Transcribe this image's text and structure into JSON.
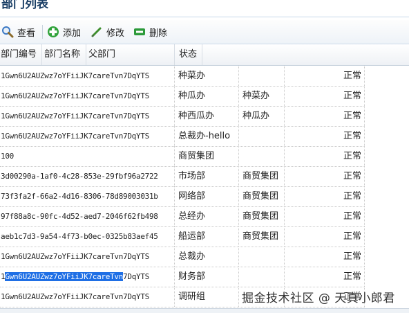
{
  "page": {
    "title": "部门列表"
  },
  "toolbar": {
    "view_label": "查看",
    "add_label": "添加",
    "edit_label": "修改",
    "delete_label": "删除"
  },
  "table": {
    "columns": [
      "部门编号",
      "部门名称",
      "父部门",
      "状态"
    ],
    "rows": [
      {
        "id": "1Gwn6U2AUZwz7oYFiiJK7careTvn7DqYTS",
        "name": "种菜办",
        "parent": "",
        "status": "正常"
      },
      {
        "id": "1Gwn6U2AUZwz7oYFiiJK7careTvn7DqYTS",
        "name": "种瓜办",
        "parent": "种菜办",
        "status": "正常"
      },
      {
        "id": "1Gwn6U2AUZwz7oYFiiJK7careTvn7DqYTS",
        "name": "种西瓜办",
        "parent": "种瓜办",
        "status": "正常"
      },
      {
        "id": "1Gwn6U2AUZwz7oYFiiJK7careTvn7DqYTS",
        "name": "总裁办-hello",
        "parent": "",
        "status": "正常"
      },
      {
        "id": "100",
        "name": "商贸集团",
        "parent": "",
        "status": "正常"
      },
      {
        "id": "3d00290a-1af0-4c28-853e-29fbf96a2722",
        "name": "市场部",
        "parent": "商贸集团",
        "status": "正常"
      },
      {
        "id": "73f3fa2f-66a2-4d16-8306-78d89003031b",
        "name": "网络部",
        "parent": "商贸集团",
        "status": "正常"
      },
      {
        "id": "97f88a8c-90fc-4d52-aed7-2046f62fb498",
        "name": "总经办",
        "parent": "商贸集团",
        "status": "正常"
      },
      {
        "id": "aeb1c7d3-9a54-4f73-b0ec-0325b83aef45",
        "name": "船运部",
        "parent": "商贸集团",
        "status": "正常"
      },
      {
        "id": "1Gwn6U2AUZwz7oYFiiJK7careTvn7DqYTS",
        "name": "总裁办",
        "parent": "",
        "status": "正常"
      },
      {
        "id_selected": "Gwn6U2AUZwz7oYFiiJK7careTvn",
        "id_prefix": "1",
        "id_suffix": "7DqYTS",
        "name": "财务部",
        "parent": "",
        "status": "正常"
      },
      {
        "id": "1Gwn6U2AUZwz7oYFiiJK7careTvn7DqYTS",
        "name": "调研组",
        "parent": "",
        "status": "正常"
      }
    ]
  },
  "watermark": "掘金技术社区 @ 天真小郎君",
  "colors": {
    "title": "#1a3f66",
    "selection": "#1f6fe5",
    "add_icon": "#2fa23a",
    "delete_icon": "#2c9a3a"
  }
}
